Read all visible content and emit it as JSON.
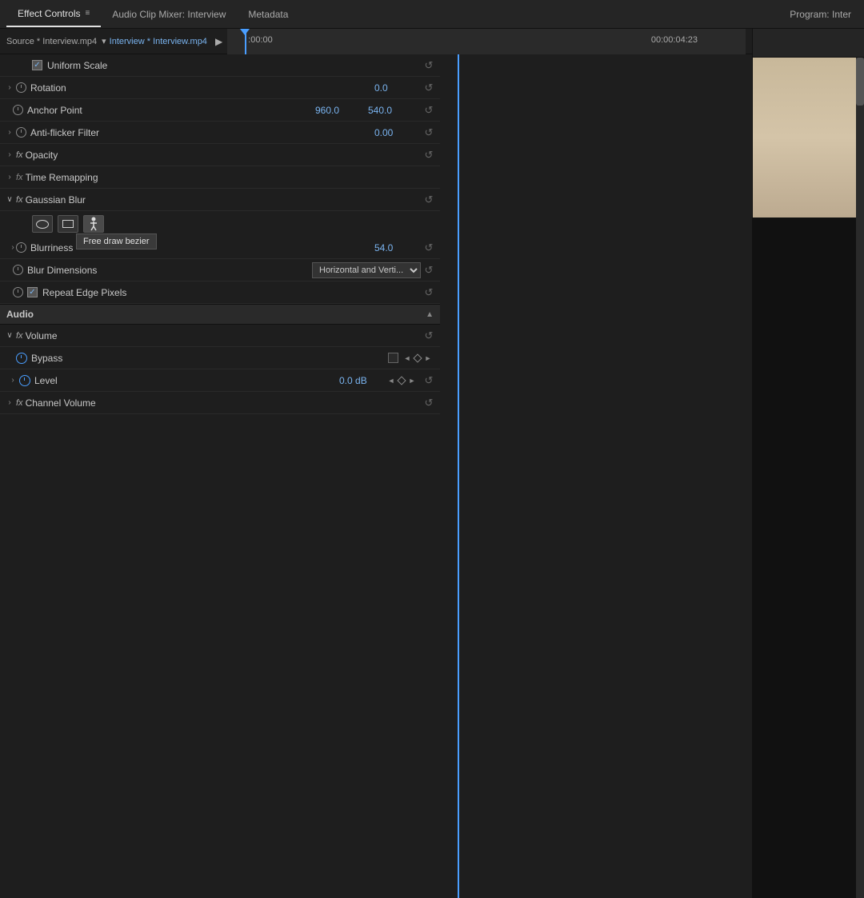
{
  "tabs": [
    {
      "label": "Effect Controls",
      "active": true,
      "hasMenu": true
    },
    {
      "label": "Audio Clip Mixer: Interview",
      "active": false
    },
    {
      "label": "Metadata",
      "active": false
    }
  ],
  "programMonitor": {
    "label": "Program: Inter"
  },
  "sourceBar": {
    "sourceText": "Source * Interview.mp4",
    "dropdownLabel": "Interview * Interview.mp4",
    "playhead": ":00:00",
    "timecode": "00:00:04:23"
  },
  "properties": {
    "uniformScale": {
      "label": "Uniform Scale",
      "checked": true
    },
    "rotation": {
      "label": "Rotation",
      "value": "0.0"
    },
    "anchorPoint": {
      "label": "Anchor Point",
      "x": "960.0",
      "y": "540.0"
    },
    "antiFlicker": {
      "label": "Anti-flicker Filter",
      "value": "0.00"
    },
    "opacity": {
      "label": "Opacity"
    },
    "timeRemapping": {
      "label": "Time Remapping"
    },
    "gaussianBlur": {
      "label": "Gaussian Blur"
    },
    "blurriness": {
      "label": "Blurriness",
      "value": "54.0"
    },
    "blurDimensions": {
      "label": "Blur Dimensions",
      "value": "Horizontal and Verti..."
    },
    "repeatEdgePixels": {
      "label": "Repeat Edge Pixels",
      "checked": true
    },
    "audio": {
      "label": "Audio"
    },
    "volume": {
      "label": "Volume"
    },
    "bypass": {
      "label": "Bypass"
    },
    "level": {
      "label": "Level",
      "value": "0.0 dB"
    },
    "channelVolume": {
      "label": "Channel Volume"
    }
  },
  "tooltip": {
    "text": "Free draw bezier"
  },
  "icons": {
    "reset": "↺",
    "expand": "›",
    "collapse": "∨",
    "chevronDown": "▾",
    "play": "▶",
    "sectionUp": "▲"
  }
}
